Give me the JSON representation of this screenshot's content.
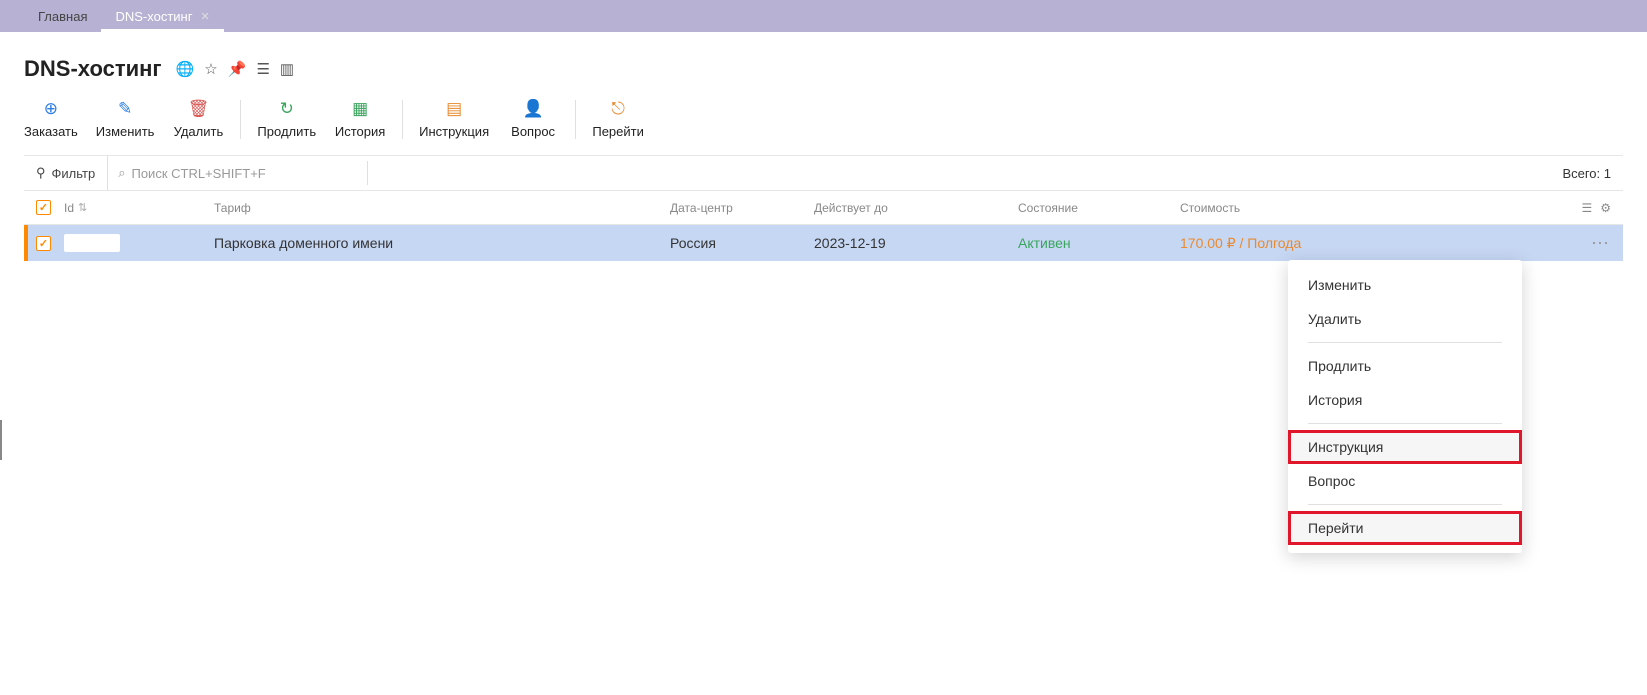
{
  "tabs": [
    {
      "label": "Главная",
      "active": false
    },
    {
      "label": "DNS-хостинг",
      "active": true
    }
  ],
  "page_title": "DNS-хостинг",
  "toolbar": {
    "order": "Заказать",
    "edit": "Изменить",
    "delete": "Удалить",
    "prolong": "Продлить",
    "history": "История",
    "instruct": "Инструкция",
    "question": "Вопрос",
    "goto": "Перейти"
  },
  "filter_label": "Фильтр",
  "search_placeholder": "Поиск CTRL+SHIFT+F",
  "total_label": "Всего: 1",
  "columns": {
    "id": "Id",
    "tariff": "Тариф",
    "datacenter": "Дата-центр",
    "valid_until": "Действует до",
    "state": "Состояние",
    "cost": "Стоимость"
  },
  "rows": [
    {
      "id": "",
      "tariff": "Парковка доменного имени",
      "datacenter": "Россия",
      "valid_until": "2023-12-19",
      "state": "Активен",
      "cost": "170.00 ₽ / Полгода"
    }
  ],
  "context_menu": {
    "edit": "Изменить",
    "delete": "Удалить",
    "prolong": "Продлить",
    "history": "История",
    "instruct": "Инструкция",
    "question": "Вопрос",
    "goto": "Перейти"
  }
}
